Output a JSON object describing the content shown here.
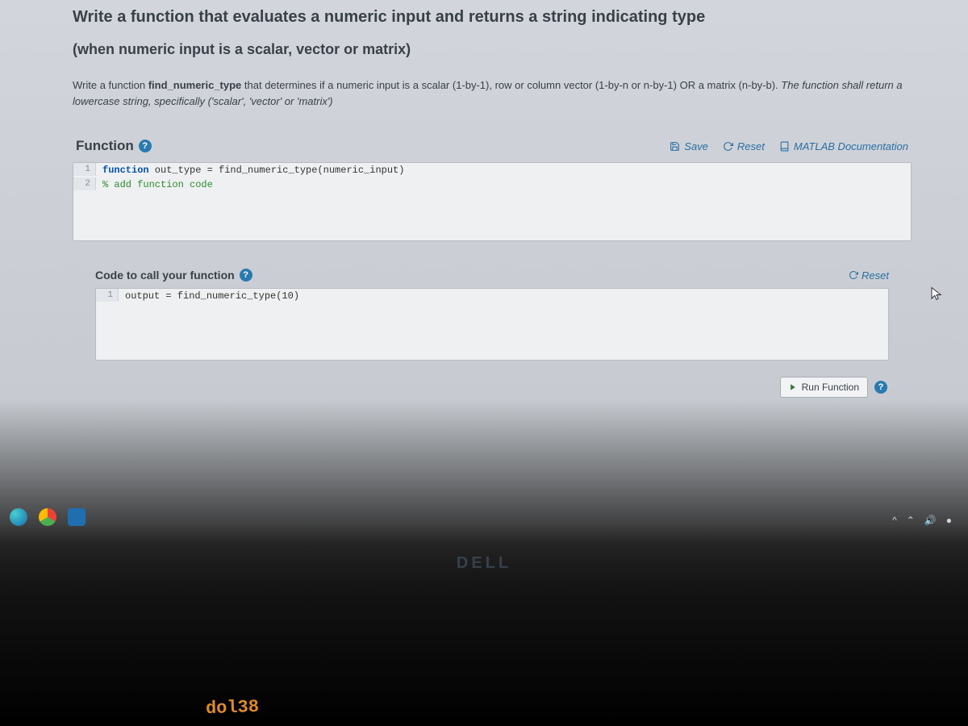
{
  "problem": {
    "title": "Write a function that evaluates a numeric input and returns a string indicating type",
    "subtitle": "(when numeric input is a scalar, vector or matrix)",
    "desc_pre": "Write a function ",
    "fn_name": "find_numeric_type",
    "desc_mid": " that determines if a numeric input is a scalar (1-by-1),  row or column vector (1-by-n or n-by-1)  OR a matrix (n-by-b).  ",
    "desc_ital": "The function shall return a lowercase string, specifically ('scalar', 'vector' or 'matrix')"
  },
  "function_section": {
    "label": "Function",
    "help": "?",
    "toolbar": {
      "save": "Save",
      "reset": "Reset",
      "docs": "MATLAB Documentation"
    },
    "code": {
      "line1_kw": "function",
      "line1_rest": " out_type = find_numeric_type(numeric_input)",
      "line2": "% add function code"
    }
  },
  "call_section": {
    "label": "Code to call your function",
    "help": "?",
    "reset": "Reset",
    "code": {
      "line1": "output = find_numeric_type(10)"
    }
  },
  "run": {
    "label": "Run Function",
    "help": "?"
  },
  "footer": {
    "brand": "DELL",
    "orange": "dol38"
  }
}
